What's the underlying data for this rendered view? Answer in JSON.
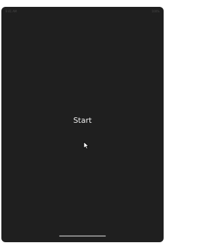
{
  "status_bar": {
    "left_text": "9:41 AM",
    "right_text": "100%"
  },
  "main": {
    "start_label": "Start"
  },
  "icons": {
    "cursor": "mouse-pointer-icon"
  },
  "colors": {
    "screen_background": "#1f1f1f",
    "text": "#f2f2f2"
  }
}
